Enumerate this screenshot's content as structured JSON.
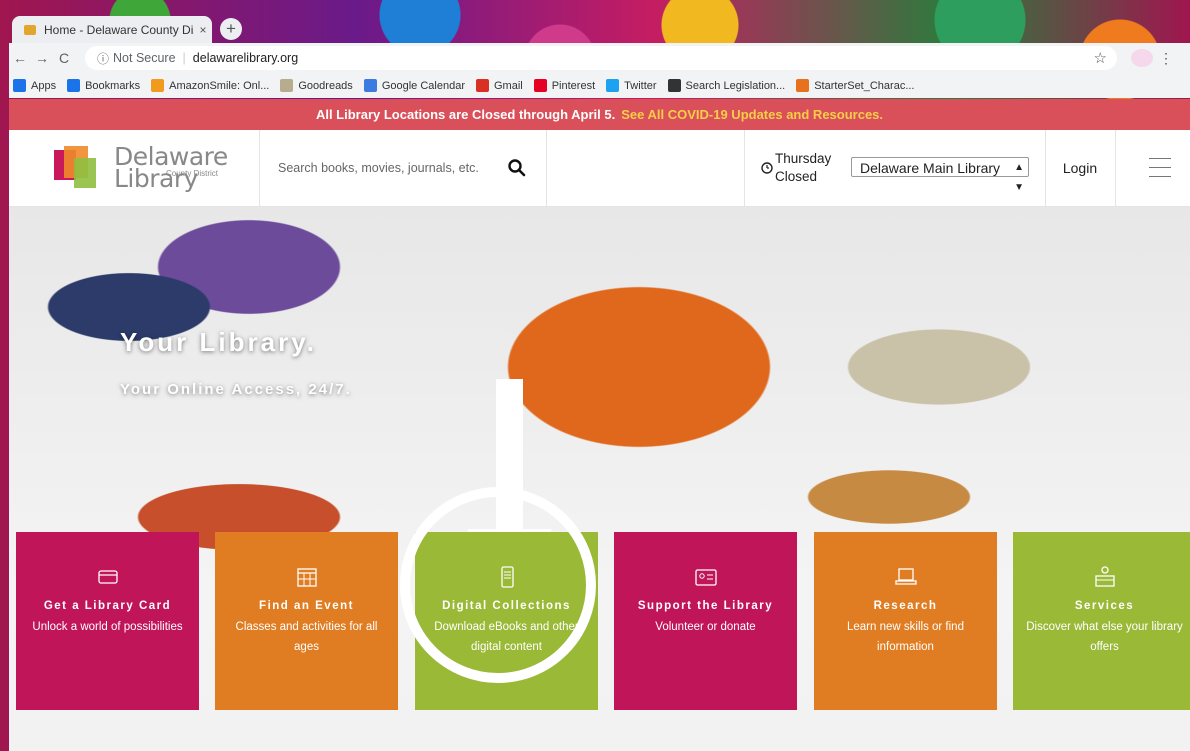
{
  "browser": {
    "tab_title": "Home - Delaware County Distri",
    "tab_close": "×",
    "new_tab": "+",
    "security_label": "Not Secure",
    "url": "delawarelibrary.org",
    "bookmarks": [
      {
        "label": "Apps",
        "icon": "apps-grid-icon",
        "color": "#1a73e8"
      },
      {
        "label": "Bookmarks",
        "icon": "star-icon",
        "color": "#1a73e8"
      },
      {
        "label": "AmazonSmile: Onl...",
        "icon": "amazon-icon",
        "color": "#f29a1e"
      },
      {
        "label": "Goodreads",
        "icon": "goodreads-icon",
        "color": "#b8ac8e"
      },
      {
        "label": "Google Calendar",
        "icon": "calendar-icon",
        "color": "#3c7be0"
      },
      {
        "label": "Gmail",
        "icon": "gmail-icon",
        "color": "#d93025"
      },
      {
        "label": "Pinterest",
        "icon": "pinterest-icon",
        "color": "#e60023"
      },
      {
        "label": "Twitter",
        "icon": "twitter-icon",
        "color": "#1da1f2"
      },
      {
        "label": "Search Legislation...",
        "icon": "legislation-icon",
        "color": "#333333"
      },
      {
        "label": "StarterSet_Charac...",
        "icon": "b-icon",
        "color": "#e8711e"
      }
    ]
  },
  "alert": {
    "text": "All Library Locations are Closed through April 5.",
    "link": "See All COVID-19 Updates and Resources."
  },
  "header": {
    "logo_line1": "Delaware",
    "logo_line2": "County District",
    "logo_line3": "Library",
    "search_placeholder": "Search books, movies, journals, etc.",
    "hours_day": "Thursday",
    "hours_status": "Closed",
    "location": "Delaware Main Library",
    "login": "Login"
  },
  "hero": {
    "title": "Your Library.",
    "subtitle": "Your Online Access, 24/7."
  },
  "tiles": [
    {
      "name": "library-card",
      "title": "Get a Library Card",
      "desc": "Unlock a world of possibilities",
      "color": "#c11559",
      "icon": "card-icon"
    },
    {
      "name": "event",
      "title": "Find an Event",
      "desc": "Classes and activities for all ages",
      "color": "#e07d22",
      "icon": "calendar-icon"
    },
    {
      "name": "digital-collections",
      "title": "Digital Collections",
      "desc": "Download eBooks and other digital content",
      "color": "#9ab936",
      "icon": "tablet-icon"
    },
    {
      "name": "support",
      "title": "Support the Library",
      "desc": "Volunteer or donate",
      "color": "#c11559",
      "icon": "id-card-icon"
    },
    {
      "name": "research",
      "title": "Research",
      "desc": "Learn new skills or find information",
      "color": "#e07d22",
      "icon": "laptop-icon"
    },
    {
      "name": "services",
      "title": "Services",
      "desc": "Discover what else your library offers",
      "color": "#9ab936",
      "icon": "desk-person-icon"
    }
  ]
}
